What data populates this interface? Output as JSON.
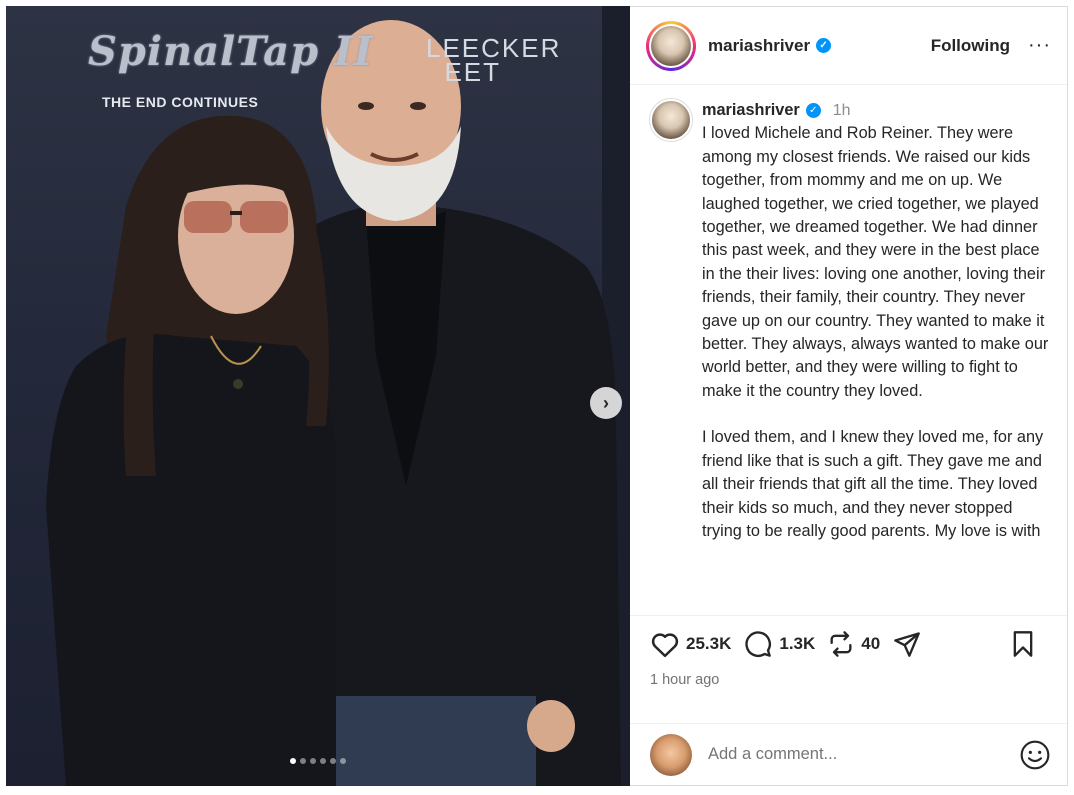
{
  "photo": {
    "backdrop_logo_title": "SpinalTap II",
    "backdrop_logo_tagline": "THE END CONTINUES",
    "backdrop_logo_bleecker": "LEECKER\nEET",
    "next_icon": "chevron-right-icon",
    "carousel_dots": 6,
    "carousel_active_index": 0
  },
  "header": {
    "username": "mariashriver",
    "verified": true,
    "follow_label": "Following",
    "more_label": "···"
  },
  "caption": {
    "username": "mariashriver",
    "time_ago": "1h",
    "paragraphs": [
      "I loved Michele and Rob Reiner. They were among my closest friends. We raised our kids together, from mommy and me on up. We laughed together, we cried together, we played together, we dreamed together. We had dinner this past week, and they were in the best place in the their lives: loving one another, loving their friends, their family, their country. They never gave up on our country. They wanted to make it better. They always, always wanted to make our world better, and they were willing to fight to make it the country they loved.",
      "I loved them, and I knew they loved me, for any friend like that is such a gift. They gave me and all their friends that gift all the time. They loved their kids so much, and they never stopped trying to be really good parents. My love is with"
    ]
  },
  "actions": {
    "likes": "25.3K",
    "comments": "1.3K",
    "reposts": "40",
    "timestamp": "1 hour ago"
  },
  "comment": {
    "placeholder": "Add a comment..."
  },
  "colors": {
    "verified_blue": "#0095f6",
    "text_primary": "#262626",
    "text_muted": "#737373"
  }
}
